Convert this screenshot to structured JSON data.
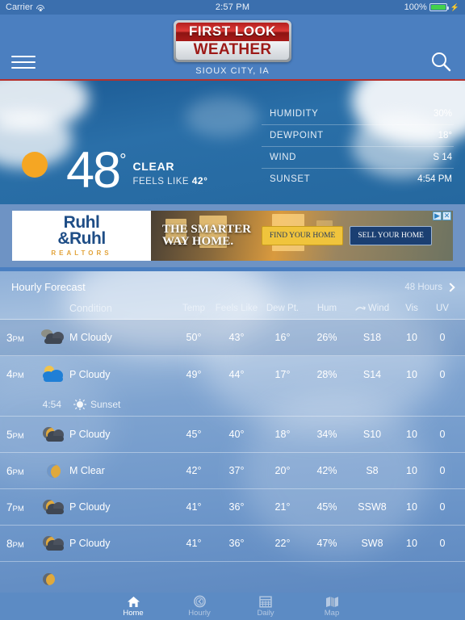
{
  "status_bar": {
    "carrier": "Carrier",
    "wifi_icon": "wifi-icon",
    "time": "2:57 PM",
    "battery_percent": "100%",
    "battery_icon": "battery-full-icon",
    "charging_icon": "lightning-bolt-icon"
  },
  "header": {
    "menu_icon": "hamburger-menu-icon",
    "search_icon": "search-icon",
    "logo_line1": "FIRST LOOK",
    "logo_line2": "WEATHER",
    "location": "SIOUX CITY, IA",
    "accent_color": "#b5302c",
    "bar_color": "#4b7fc0"
  },
  "current": {
    "sun_icon": "sun-icon",
    "temperature": "48",
    "degree_symbol": "°",
    "condition": "CLEAR",
    "feels_like_label": "FEELS LIKE",
    "feels_like_value": "42°",
    "details": [
      {
        "label": "HUMIDITY",
        "value": "30%"
      },
      {
        "label": "DEWPOINT",
        "value": "18°"
      },
      {
        "label": "WIND",
        "value": "S 14"
      },
      {
        "label": "SUNSET",
        "value": "4:54 PM"
      }
    ]
  },
  "ad": {
    "brand_line1": "Ruhl",
    "brand_line2": "&Ruhl",
    "brand_sub": "REALTORS",
    "tagline_line1": "THE SMARTER",
    "tagline_line2": "WAY HOME.",
    "button_find": "FIND YOUR HOME",
    "button_sell": "SELL YOUR HOME",
    "adchoices_icon": "adchoices-icon",
    "close_icon": "close-icon"
  },
  "hourly": {
    "title": "Hourly Forecast",
    "link_label": "48 Hours",
    "link_chevron_icon": "chevron-right-icon",
    "columns": {
      "time": "",
      "condition": "Condition",
      "temp": "Temp",
      "feels_like": "Feels Like",
      "dew_point": "Dew Pt.",
      "hum": "Hum",
      "wind_icon": "wind-arrow-icon",
      "wind": "Wind",
      "vis": "Vis",
      "uv": "UV"
    },
    "rows": [
      {
        "time": "3",
        "ampm": "PM",
        "icon": "mostly-cloudy-icon",
        "condition": "M Cloudy",
        "temp": "50°",
        "feels_like": "43°",
        "dew_point": "16°",
        "hum": "26%",
        "wind": "S18",
        "vis": "10",
        "uv": "0"
      },
      {
        "time": "4",
        "ampm": "PM",
        "icon": "partly-cloudy-day-icon",
        "condition": "P Cloudy",
        "temp": "49°",
        "feels_like": "44°",
        "dew_point": "17°",
        "hum": "28%",
        "wind": "S14",
        "vis": "10",
        "uv": "0"
      },
      {
        "time": "5",
        "ampm": "PM",
        "icon": "partly-cloudy-night-icon",
        "condition": "P Cloudy",
        "temp": "45°",
        "feels_like": "40°",
        "dew_point": "18°",
        "hum": "34%",
        "wind": "S10",
        "vis": "10",
        "uv": "0"
      },
      {
        "time": "6",
        "ampm": "PM",
        "icon": "mostly-clear-night-icon",
        "condition": "M Clear",
        "temp": "42°",
        "feels_like": "37°",
        "dew_point": "20°",
        "hum": "42%",
        "wind": "S8",
        "vis": "10",
        "uv": "0"
      },
      {
        "time": "7",
        "ampm": "PM",
        "icon": "partly-cloudy-night-icon",
        "condition": "P Cloudy",
        "temp": "41°",
        "feels_like": "36°",
        "dew_point": "21°",
        "hum": "45%",
        "wind": "SSW8",
        "vis": "10",
        "uv": "0"
      },
      {
        "time": "8",
        "ampm": "PM",
        "icon": "partly-cloudy-night-icon",
        "condition": "P Cloudy",
        "temp": "41°",
        "feels_like": "36°",
        "dew_point": "22°",
        "hum": "47%",
        "wind": "SW8",
        "vis": "10",
        "uv": "0"
      }
    ],
    "sunset_event": {
      "time": "4:54",
      "icon": "sunset-icon",
      "label": "Sunset",
      "after_row_index": 1
    }
  },
  "tabbar": {
    "items": [
      {
        "label": "Home",
        "icon": "home-icon",
        "active": true
      },
      {
        "label": "Hourly",
        "icon": "clock-icon",
        "active": false
      },
      {
        "label": "Daily",
        "icon": "calendar-icon",
        "active": false
      },
      {
        "label": "Map",
        "icon": "map-icon",
        "active": false
      }
    ]
  }
}
